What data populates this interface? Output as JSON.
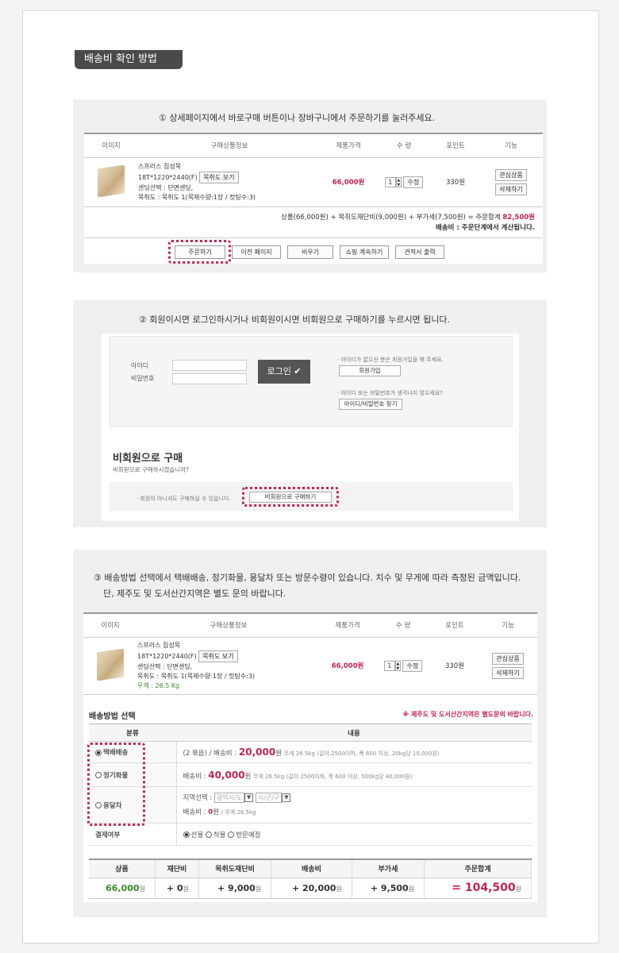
{
  "title": "배송비 확인 방법",
  "step1": {
    "text": "① 상세페이지에서 바로구매 버튼이나 장바구니에서 주문하기를 눌러주세요.",
    "headers": [
      "이미지",
      "구매상품정보",
      "제품가격",
      "수 량",
      "포인트",
      "기능"
    ],
    "product": {
      "name": "스프러스 집성목",
      "size": "18T*1220*2440(F)",
      "option_btn": "목취도 보기",
      "sanding": "샌딩선택 : 단면샌딩,",
      "mokchwido": "목취도 : 목취도 1(목재수량:1장 / 컷팅수:3)",
      "price": "66,000원",
      "qty": "1",
      "qty_btn": "수정",
      "point": "330원",
      "wish_btn": "관심상품",
      "delete_btn": "삭제하기"
    },
    "summary_prefix": "상품(66,000원) + 목취도재단비(9,000원) + 부가세(7,500원) = 주문합계",
    "summary_total": "82,500원",
    "shipping_line": "배송비 : 주문단계에서 계산됩니다.",
    "buttons": [
      "주문하기",
      "이전 페이지",
      "비우기",
      "쇼핑 계속하기",
      "견적서 출력"
    ]
  },
  "step2": {
    "text": "② 회원이시면 로그인하시거나 비회원이시면 비회원으로 구매하기를 누르시면 됩니다.",
    "id_label": "아이디",
    "pw_label": "비밀번호",
    "login_btn": "로그인 ✔",
    "join_note": "· 아이디가 없으신 분은 회원가입을 해 주세요.",
    "join_btn": "회원가입",
    "find_note": "· 아이디 또는 비밀번호가 생각나지 않으세요?",
    "find_btn": "아이디/비밀번호 찾기",
    "nonmember_title": "비회원으로 구매",
    "nonmember_sub": "비회원으로 구매하시겠습니까?",
    "nonmember_note": "· 회원이 아니셔도 구매하실 수 있습니다.",
    "nonmember_btn": "비회원으로 구매하기"
  },
  "step3": {
    "text_line1": "③ 배송방법 선택에서 택배배송, 정기화물, 용달차 또는 방문수령이 있습니다. 치수 및 무게에 따라 측정된 금액입니다.",
    "text_line2": "단, 제주도 및 도서산간지역은 별도 문의 바랍니다.",
    "weight": "무게 : 26.5 Kg",
    "ship_header": "배송방법 선택",
    "ship_note": "※ 제주도 및 도서산간지역은 별도문의 바랍니다.",
    "col_category": "분류",
    "col_content": "내용",
    "options": [
      {
        "label": "택배배송",
        "selected": true,
        "detail_prefix": "(2 묶음) / 배송비  :",
        "amount": "20,000",
        "unit": "원",
        "detail_suffix": "무게 26.5kg (길이:2500이하, 폭 600 이상, 20kg당 10,000원)"
      },
      {
        "label": "정기화물",
        "selected": false,
        "detail_prefix": "배송비  :",
        "amount": "40,000",
        "unit": "원",
        "detail_suffix": "무게 26.5kg (길이:2500이하, 폭 600 이상, 500kg당 40,000원)"
      },
      {
        "label": "용달차",
        "selected": false,
        "region_label": "지역선택 :",
        "sel1": "광역시/도",
        "sel2": "시/군/구",
        "detail_prefix": "배송비  :",
        "amount": "0",
        "unit": "원",
        "detail_suffix": "/ 무게 26.5kg"
      }
    ],
    "payment_label": "결제여부",
    "payment_options": [
      "선불",
      "착불",
      "방문예정"
    ],
    "totals_headers": [
      "상품",
      "재단비",
      "목취도재단비",
      "배송비",
      "부가세",
      "주문합계"
    ],
    "totals_values": [
      "66,000",
      "+ 0",
      "+ 9,000",
      "+ 20,000",
      "+ 9,500",
      "= 104,500"
    ],
    "won": "원"
  }
}
